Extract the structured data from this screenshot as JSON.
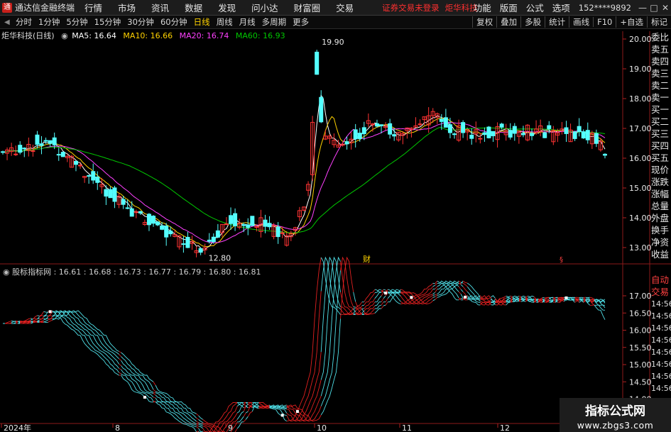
{
  "menubar": {
    "app_title": "通达信金融终端",
    "items": [
      "行情",
      "市场",
      "资讯",
      "数据",
      "发现",
      "问小达",
      "财富圈",
      "交易"
    ],
    "notice": "证券交易未登录",
    "notice2": "炬华科技",
    "right_items": [
      "功能",
      "版面",
      "公式",
      "选项"
    ],
    "account": "152****9892"
  },
  "toolbar": {
    "periods": [
      "分时",
      "1分钟",
      "5分钟",
      "15分钟",
      "30分钟",
      "60分钟",
      "日线",
      "周线",
      "月线",
      "多周期",
      "更多"
    ],
    "active_period": "日线",
    "right_items": [
      "复权",
      "叠加",
      "多股",
      "统计",
      "画线",
      "F10",
      "+自选",
      "标记"
    ]
  },
  "kline": {
    "title": "炬华科技(日线)",
    "ma5": "MA5: 16.64",
    "ma10": "MA10: 16.66",
    "ma20": "MA20: 16.74",
    "ma60": "MA60: 16.93",
    "colors": {
      "ma5": "#ffffff",
      "ma10": "#ffd200",
      "ma20": "#ff40ff",
      "ma60": "#00c800",
      "up": "#ff3333",
      "down": "#54ffff"
    },
    "y_ticks": [
      "20.00",
      "19.00",
      "18.00",
      "17.00",
      "16.00",
      "15.00",
      "14.00",
      "13.00"
    ],
    "high_label": "19.90",
    "low_label": "12.80",
    "fin_marker": "财"
  },
  "sub": {
    "title": "股标指标网",
    "values": ": 16.61 : 16.68 : 16.73 : 16.77 : 16.79 : 16.80 : 16.81",
    "y_ticks": [
      "17.00",
      "16.50",
      "16.00",
      "15.50",
      "15.00",
      "14.50",
      "14.00",
      "13.50"
    ]
  },
  "x_axis": [
    "2024年",
    "8",
    "9",
    "10",
    "11",
    "12"
  ],
  "sidebar": {
    "items": [
      "委比",
      "卖五",
      "卖四",
      "卖三",
      "卖二",
      "卖一",
      "买一",
      "买二",
      "买三",
      "买四",
      "买五",
      "现价",
      "涨跌",
      "涨幅",
      "总量",
      "外盘",
      "换手",
      "净资",
      "收益"
    ],
    "auto": "自动",
    "trade": "交易",
    "ticks": [
      "14:56",
      "14:56",
      "14:56",
      "14:56",
      "14:56",
      "14:56",
      "14:56",
      "14:56",
      "14:56",
      "14:56"
    ]
  },
  "watermark": {
    "title": "指标公式网",
    "url": "www.zbgs3.com"
  }
}
